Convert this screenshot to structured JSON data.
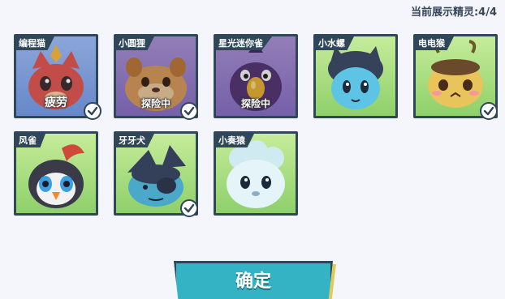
{
  "header": {
    "display_counter": "当前展示精灵:4/4"
  },
  "pets": [
    {
      "name": "编程猫",
      "status": "疲劳",
      "selected": true,
      "bg": "#7fa8e8",
      "icon": "red-cat-pet-icon"
    },
    {
      "name": "小圆狸",
      "status": "探险中",
      "selected": true,
      "bg": "#a58ad8",
      "icon": "round-raccoon-pet-icon"
    },
    {
      "name": "星光迷你雀",
      "status": "探险中",
      "selected": false,
      "bg": "#a58ad8",
      "icon": "purple-bird-pet-icon"
    },
    {
      "name": "小水螺",
      "status": "",
      "selected": false,
      "bg": "#a9e07a",
      "icon": "water-snail-pet-icon"
    },
    {
      "name": "电电猴",
      "status": "",
      "selected": true,
      "bg": "#a9e07a",
      "icon": "electric-monkey-pet-icon"
    },
    {
      "name": "风雀",
      "status": "",
      "selected": false,
      "bg": "#a9e07a",
      "icon": "wind-sparrow-pet-icon"
    },
    {
      "name": "牙牙犬",
      "status": "",
      "selected": true,
      "bg": "#a9e07a",
      "icon": "fang-dog-pet-icon"
    },
    {
      "name": "小奏猿",
      "status": "",
      "selected": false,
      "bg": "#a9e07a",
      "icon": "fluffy-monkey-pet-icon"
    }
  ],
  "footer": {
    "confirm_label": "确定"
  },
  "colors": {
    "border": "#2f4759",
    "confirm": "#34b3c4"
  }
}
